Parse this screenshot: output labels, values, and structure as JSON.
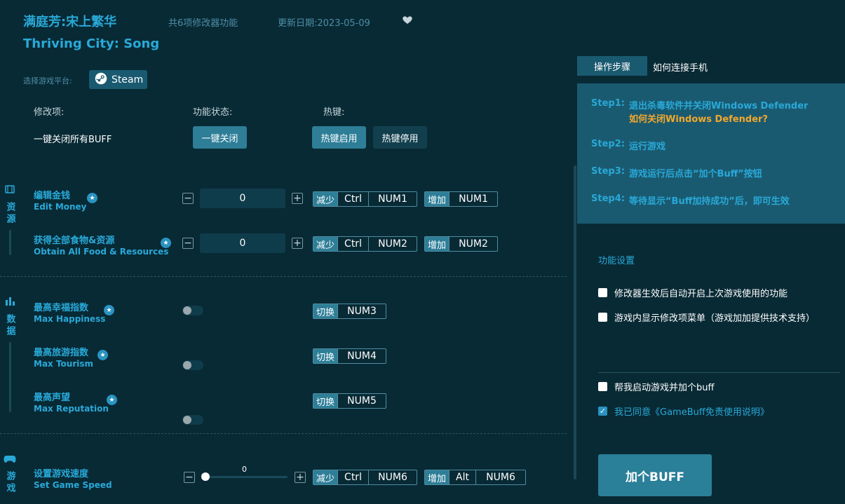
{
  "header": {
    "title_cn": "满庭芳:宋上繁华",
    "title_en": "Thriving City: Song",
    "feature_count": "共6项修改器功能",
    "update_date": "更新日期:2023-05-09",
    "favorite_icon": "heart-icon"
  },
  "platform": {
    "label": "选择游戏平台:",
    "selected": "Steam"
  },
  "columns": {
    "mod": "修改项:",
    "status": "功能状态:",
    "hotkey": "热键:"
  },
  "global_row": {
    "label": "一键关闭所有BUFF",
    "close_all": "一键关闭",
    "hotkey_on": "热键启用",
    "hotkey_off": "热键停用"
  },
  "categories": {
    "resources": "资源",
    "data": "数据",
    "game": "游戏"
  },
  "items": [
    {
      "cn": "编辑金钱",
      "en": "Edit Money",
      "value": "0",
      "dec_tag": "减少",
      "dec_keys": [
        "Ctrl",
        "NUM1"
      ],
      "inc_tag": "增加",
      "inc_keys": [
        "NUM1"
      ]
    },
    {
      "cn": "获得全部食物&资源",
      "en": "Obtain All Food & Resources",
      "value": "0",
      "dec_tag": "减少",
      "dec_keys": [
        "Ctrl",
        "NUM2"
      ],
      "inc_tag": "增加",
      "inc_keys": [
        "NUM2"
      ]
    },
    {
      "cn": "最高幸福指数",
      "en": "Max Happiness",
      "tag": "切换",
      "key": "NUM3",
      "enabled": false
    },
    {
      "cn": "最高旅游指数",
      "en": "Max Tourism",
      "tag": "切换",
      "key": "NUM4",
      "enabled": false
    },
    {
      "cn": "最高声望",
      "en": "Max Reputation",
      "tag": "切换",
      "key": "NUM5",
      "enabled": false
    },
    {
      "cn": "设置游戏速度",
      "en": "Set Game Speed",
      "value": "0",
      "dec_tag": "减少",
      "dec_keys": [
        "Ctrl",
        "NUM6"
      ],
      "inc_tag": "增加",
      "inc_keys": [
        "Alt",
        "NUM6"
      ]
    }
  ],
  "stepper": {
    "minus": "−",
    "plus": "+"
  },
  "right_tabs": {
    "steps": "操作步骤",
    "phone": "如何连接手机"
  },
  "steps": [
    {
      "label": "Step1:",
      "text": "退出杀毒软件并关闭Windows Defender",
      "link": "如何关闭Windows Defender?"
    },
    {
      "label": "Step2:",
      "text": "运行游戏"
    },
    {
      "label": "Step3:",
      "text": "游戏运行后点击“加个Buff”按钮"
    },
    {
      "label": "Step4:",
      "text": "等待显示“Buff加持成功”后，即可生效"
    }
  ],
  "settings": {
    "title": "功能设置",
    "auto_enable": "修改器生效后自动开启上次游戏使用的功能",
    "show_menu": "游戏内显示修改项菜单（游戏加加提供技术支持）",
    "launch_with_buff": "帮我启动游戏并加个buff",
    "agree": "我已同意《GameBuff免责使用说明》",
    "agree_checked": true
  },
  "buff_button": "加个BUFF",
  "colors": {
    "background": "#082a35",
    "accent": "#29a9d8",
    "panel": "#1a5a70",
    "link": "#f2a82d"
  }
}
